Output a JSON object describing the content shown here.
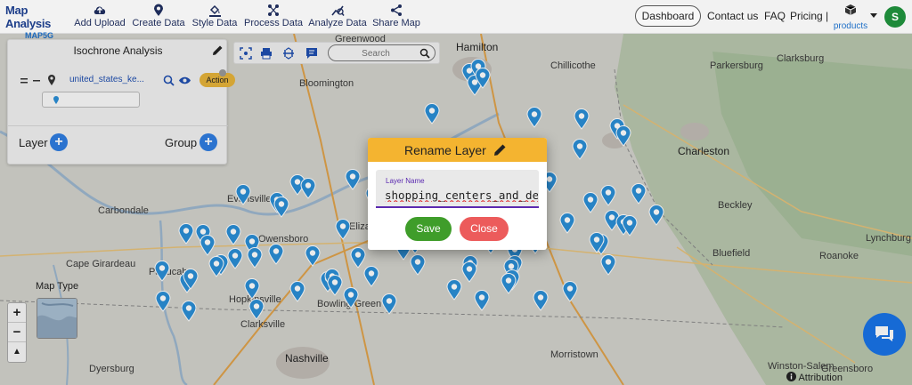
{
  "navbar": {
    "brand_title": "Map Analysis",
    "brand_sub": "MAP5G",
    "items": [
      {
        "label": "Add Upload",
        "icon": "cloud-upload-icon"
      },
      {
        "label": "Create Data",
        "icon": "map-pin-icon"
      },
      {
        "label": "Style Data",
        "icon": "paint-bucket-icon"
      },
      {
        "label": "Process Data",
        "icon": "process-icon"
      },
      {
        "label": "Analyze Data",
        "icon": "analyze-icon"
      },
      {
        "label": "Share Map",
        "icon": "share-icon"
      }
    ],
    "dashboard_label": "Dashboard",
    "contact_label": "Contact us",
    "faq_label": "FAQ",
    "pricing_label": "Pricing |",
    "products_label": "products",
    "avatar_initial": "S"
  },
  "panel": {
    "title": "Isochrone Analysis",
    "layer_name": "united_states_ke...",
    "action_label": "Action",
    "layer_label": "Layer",
    "group_label": "Group"
  },
  "toolbar": {
    "search_placeholder": "Search"
  },
  "map": {
    "labels": [
      "Hamilton",
      "Chillicothe",
      "Parkersburg",
      "Clarksburg",
      "Bloomington",
      "Greenwood",
      "Charleston",
      "Carbondale",
      "Evansville",
      "Owensboro",
      "Elizabethtown",
      "Beckley",
      "Bluefield",
      "Cape Girardeau",
      "Paducah",
      "Hopkinsville",
      "Bowling Green",
      "Clarksville",
      "Roanoke",
      "Lynchburg",
      "Nashville",
      "Dyersburg",
      "Morristown",
      "Winston-Salem",
      "Greensboro"
    ],
    "maptype_label": "Map Type",
    "attribution_label": "Attribution",
    "zoom_in": "+",
    "zoom_out": "−",
    "reset": "▲"
  },
  "dialog": {
    "title": "Rename Layer",
    "field_label": "Layer Name",
    "field_value": "shopping_centers_and_dep",
    "save_label": "Save",
    "close_label": "Close"
  },
  "colors": {
    "accent_header": "#f4b430",
    "save_green": "#3f9d2a",
    "close_red": "#ec5b5b",
    "pin_blue": "#2b8fd6",
    "brand_blue": "#1d3e8a"
  }
}
